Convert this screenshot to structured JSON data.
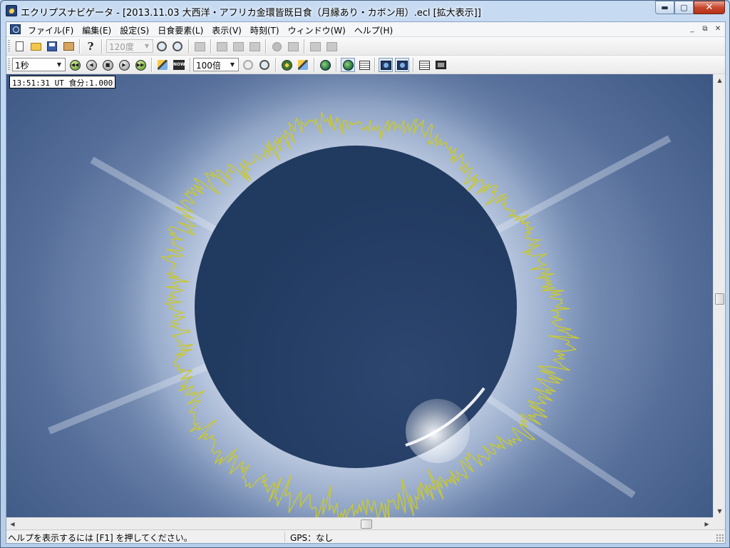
{
  "window": {
    "title": "エクリプスナビゲータ - [2013.11.03 大西洋・アフリカ金環皆既日食（月縁あり・カボン用）.ecl [拡大表示]]"
  },
  "caption_buttons": {
    "minimize": "▬",
    "maximize": "▢",
    "close": "✕"
  },
  "menu": {
    "items": [
      "ファイル(F)",
      "編集(E)",
      "設定(S)",
      "日食要素(L)",
      "表示(V)",
      "時刻(T)",
      "ウィンドウ(W)",
      "ヘルプ(H)"
    ],
    "mdi_buttons": [
      "_",
      "⧉",
      "✕"
    ]
  },
  "toolbar1": {
    "zoom_angle": "120度"
  },
  "toolbar2": {
    "time_step": "1秒",
    "magnification": "100倍"
  },
  "icons": {
    "new": "page-icon",
    "open": "folder-icon",
    "save": "save-icon",
    "print": "print-icon",
    "help": "help-icon"
  },
  "overlay": {
    "status": "13:51:31 UT 食分:1.000"
  },
  "statusbar": {
    "help_text": "ヘルプを表示するには [F1] を押してください。",
    "gps": "GPS：なし"
  },
  "scroll": {
    "up": "▲",
    "down": "▼",
    "left": "◀",
    "right": "▶"
  },
  "colors": {
    "moon": "#233a60",
    "limb_profile": "#c8c832",
    "corona_center": "#a9b9d3",
    "sky_edge": "#34507c"
  }
}
